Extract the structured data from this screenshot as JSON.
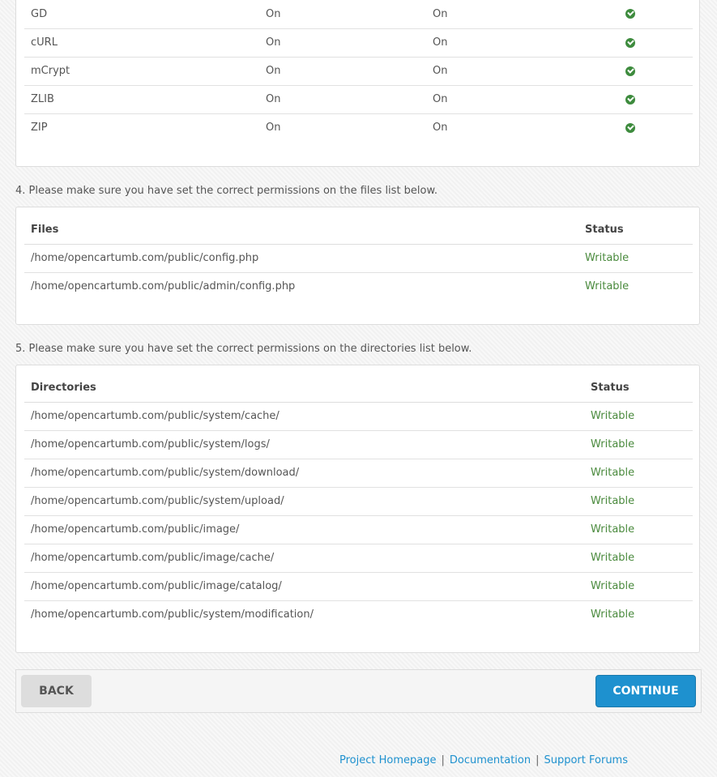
{
  "extensions": {
    "rows": [
      {
        "name": "GD",
        "current": "On",
        "required": "On"
      },
      {
        "name": "cURL",
        "current": "On",
        "required": "On"
      },
      {
        "name": "mCrypt",
        "current": "On",
        "required": "On"
      },
      {
        "name": "ZLIB",
        "current": "On",
        "required": "On"
      },
      {
        "name": "ZIP",
        "current": "On",
        "required": "On"
      }
    ],
    "status_icon": "check-circle-icon"
  },
  "files": {
    "instruction": "4. Please make sure you have set the correct permissions on the files list below.",
    "col_path": "Files",
    "col_status": "Status",
    "rows": [
      {
        "path": "/home/opencartumb.com/public/config.php",
        "status": "Writable"
      },
      {
        "path": "/home/opencartumb.com/public/admin/config.php",
        "status": "Writable"
      }
    ]
  },
  "directories": {
    "instruction": "5. Please make sure you have set the correct permissions on the directories list below.",
    "col_path": "Directories",
    "col_status": "Status",
    "rows": [
      {
        "path": "/home/opencartumb.com/public/system/cache/",
        "status": "Writable"
      },
      {
        "path": "/home/opencartumb.com/public/system/logs/",
        "status": "Writable"
      },
      {
        "path": "/home/opencartumb.com/public/system/download/",
        "status": "Writable"
      },
      {
        "path": "/home/opencartumb.com/public/system/upload/",
        "status": "Writable"
      },
      {
        "path": "/home/opencartumb.com/public/image/",
        "status": "Writable"
      },
      {
        "path": "/home/opencartumb.com/public/image/cache/",
        "status": "Writable"
      },
      {
        "path": "/home/opencartumb.com/public/image/catalog/",
        "status": "Writable"
      },
      {
        "path": "/home/opencartumb.com/public/system/modification/",
        "status": "Writable"
      }
    ]
  },
  "buttons": {
    "back": "BACK",
    "continue": "CONTINUE"
  },
  "footer": {
    "links": [
      "Project Homepage",
      "Documentation",
      "Support Forums"
    ],
    "separator": "|"
  },
  "colors": {
    "accent": "#1e91cf",
    "success": "#3d8b3d",
    "writable": "#4a8a3d"
  }
}
